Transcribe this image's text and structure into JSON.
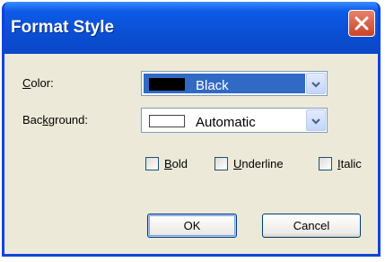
{
  "window": {
    "title": "Format Style"
  },
  "form": {
    "color_label": "Color:",
    "color_value": "Black",
    "color_swatch": "#000000",
    "background_label": "Background:",
    "background_value": "Automatic",
    "background_swatch": "#ffffff"
  },
  "checkboxes": [
    {
      "label": "Bold",
      "checked": false
    },
    {
      "label": "Underline",
      "checked": false
    },
    {
      "label": "Italic",
      "checked": false
    }
  ],
  "buttons": {
    "ok": "OK",
    "cancel": "Cancel"
  },
  "colors": {
    "titlebar": "#0a4fd4",
    "dialog_bg": "#ece9d8",
    "selection": "#316ac5",
    "close_button": "#d65a3c"
  }
}
